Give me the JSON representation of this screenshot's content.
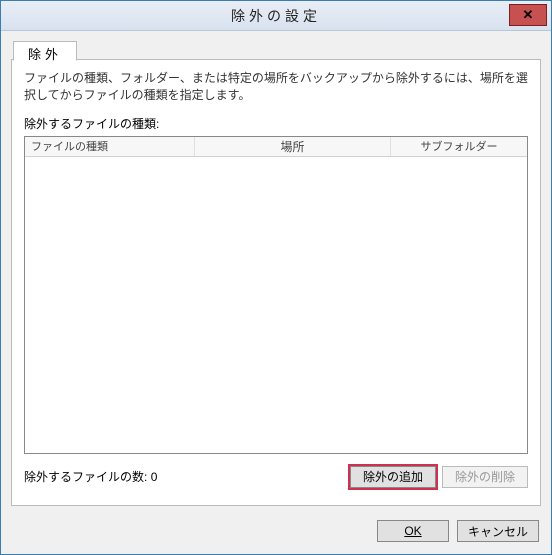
{
  "window": {
    "title": "除外の設定"
  },
  "tab": {
    "label": "除外"
  },
  "description": "ファイルの種類、フォルダー、または特定の場所をバックアップから除外するには、場所を選択してからファイルの種類を指定します。",
  "list": {
    "label": "除外するファイルの種類:",
    "columns": {
      "type": "ファイルの種類",
      "location": "場所",
      "subfolder": "サブフォルダー"
    },
    "rows": []
  },
  "count": {
    "label": "除外するファイルの数:",
    "value": "0"
  },
  "buttons": {
    "add": "除外の追加",
    "remove": "除外の削除",
    "ok": "OK",
    "cancel": "キャンセル"
  }
}
